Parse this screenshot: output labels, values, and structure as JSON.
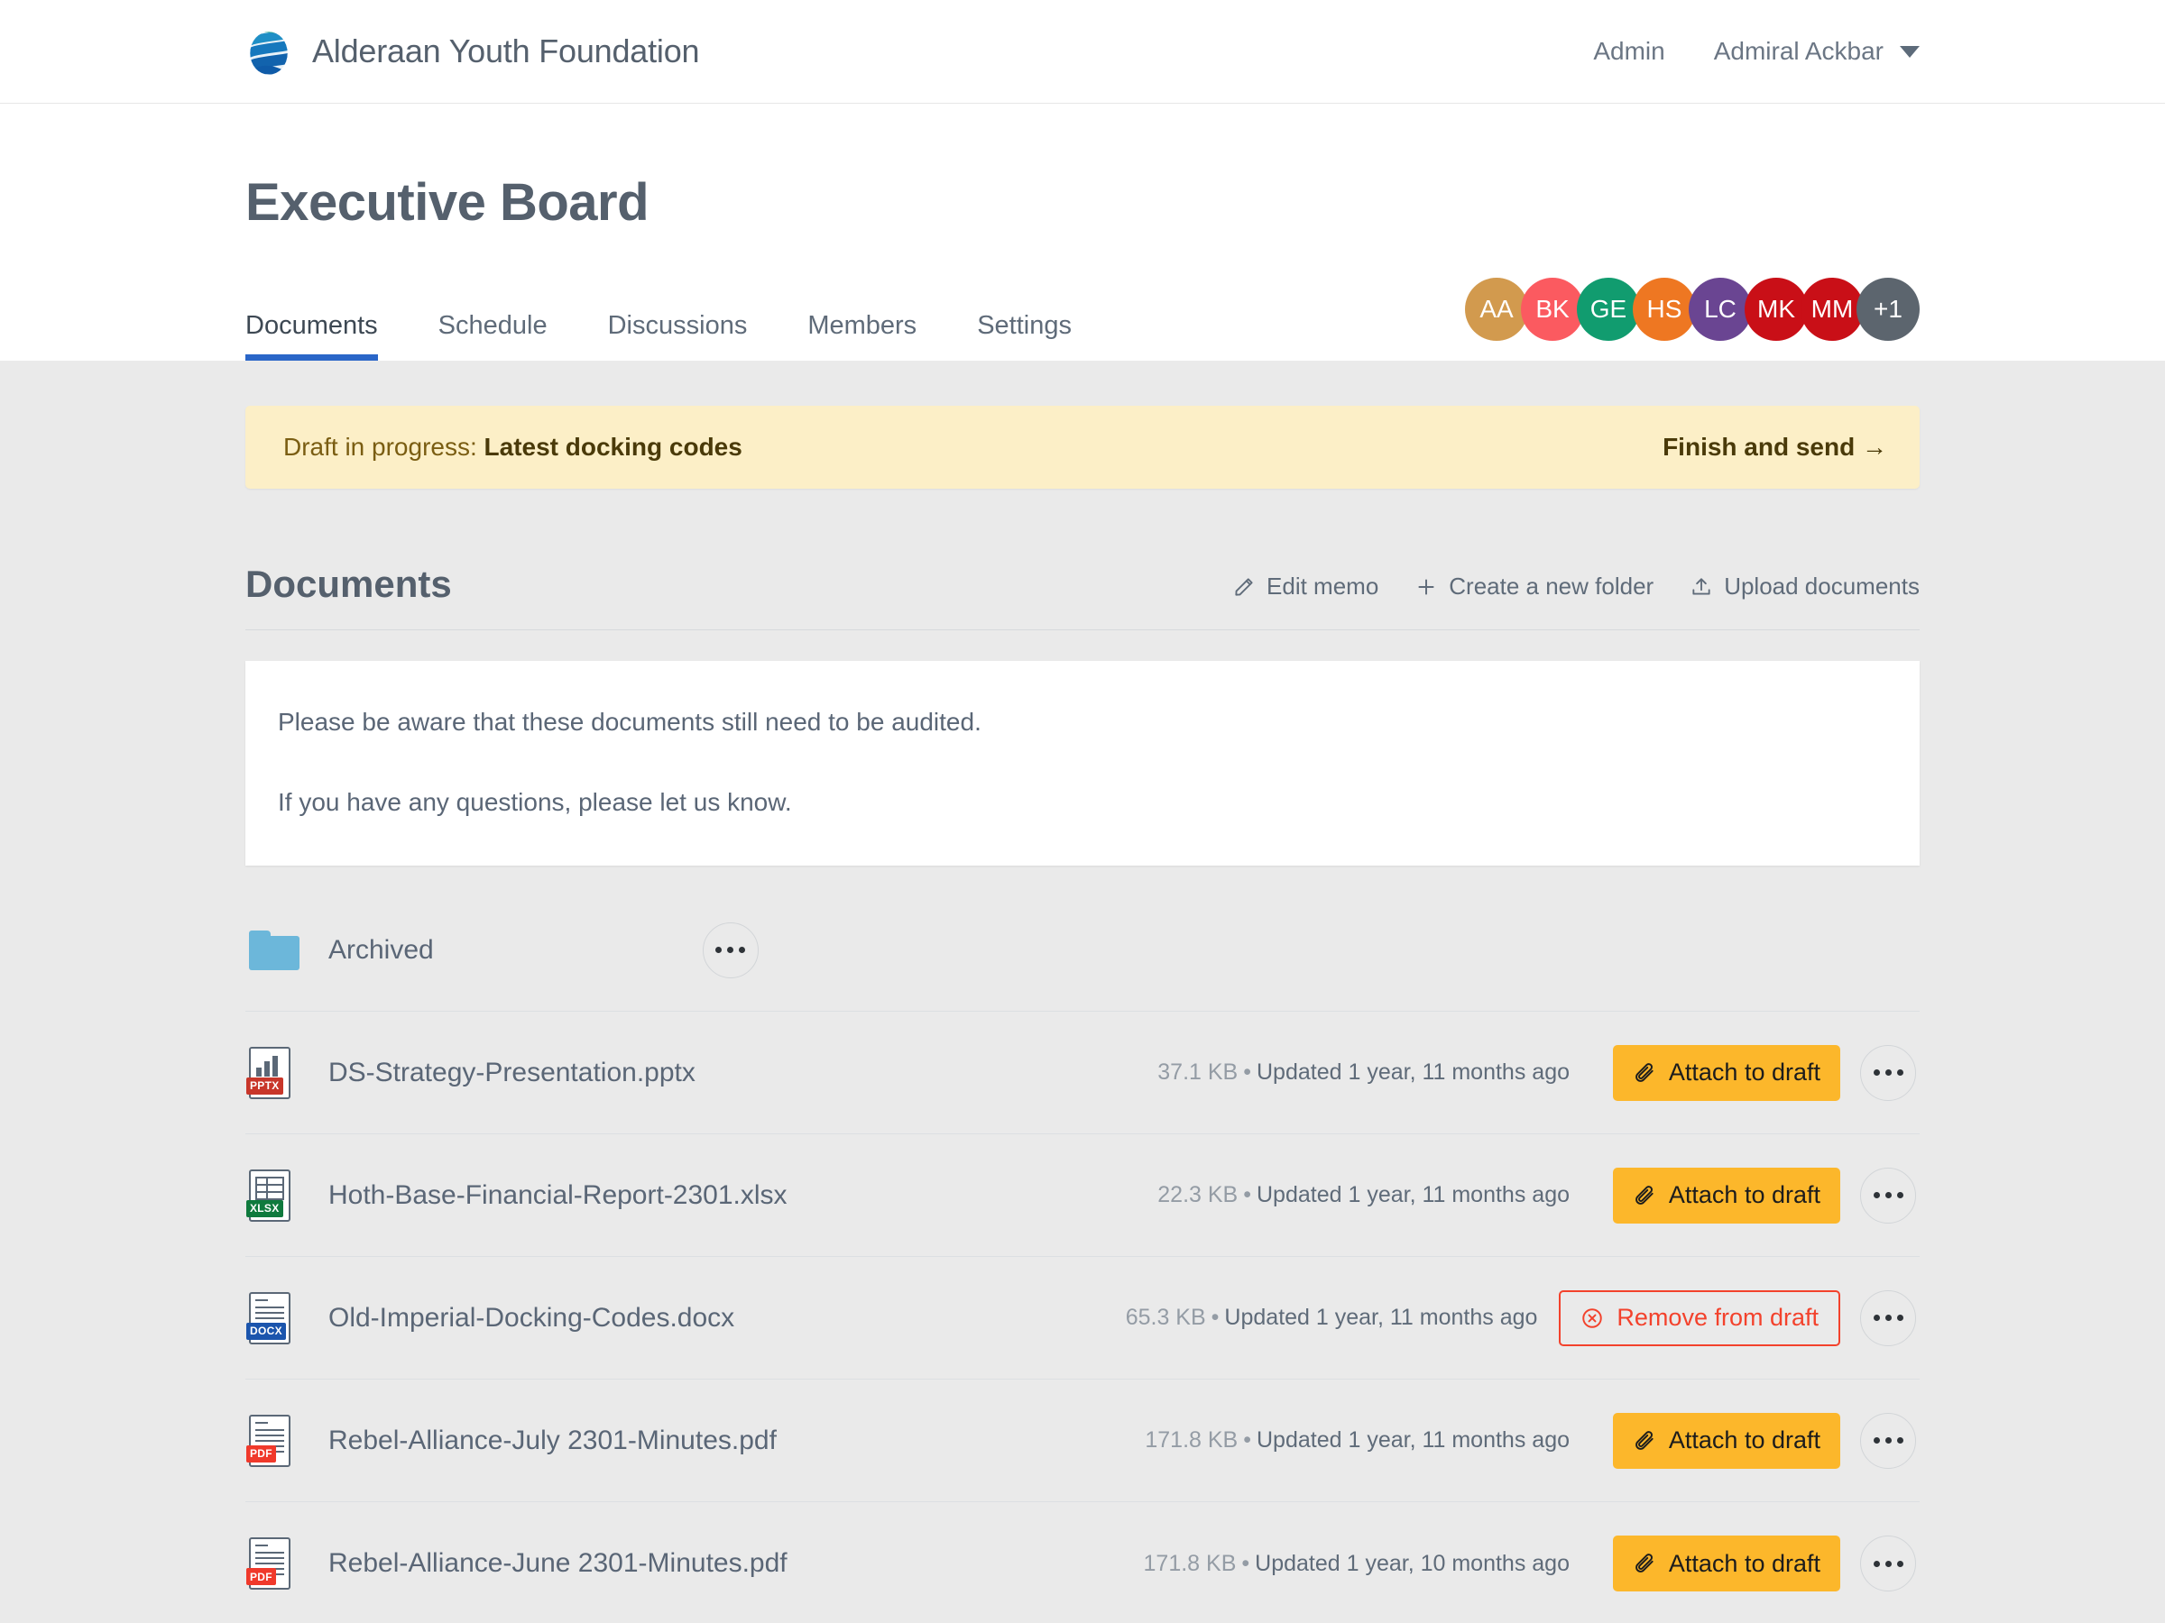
{
  "header": {
    "logo_icon": "globe-logo-icon",
    "brand": "Alderaan Youth Foundation",
    "admin_link": "Admin",
    "user_name": "Admiral Ackbar",
    "caret_icon": "chevron-down-icon"
  },
  "page": {
    "title": "Executive Board"
  },
  "tabs": [
    {
      "label": "Documents",
      "active": true
    },
    {
      "label": "Schedule",
      "active": false
    },
    {
      "label": "Discussions",
      "active": false
    },
    {
      "label": "Members",
      "active": false
    },
    {
      "label": "Settings",
      "active": false
    }
  ],
  "avatars": [
    {
      "initials": "AA",
      "color": "#d29a4e"
    },
    {
      "initials": "BK",
      "color": "#fb5a60"
    },
    {
      "initials": "GE",
      "color": "#119c6f"
    },
    {
      "initials": "HS",
      "color": "#ee7722"
    },
    {
      "initials": "LC",
      "color": "#6a4592"
    },
    {
      "initials": "MK",
      "color": "#c90f17"
    },
    {
      "initials": "MM",
      "color": "#c90f17"
    },
    {
      "initials": "+1",
      "color": "#5c656e"
    }
  ],
  "banner": {
    "prefix": "Draft in progress: ",
    "draft_name": "Latest docking codes",
    "action_label": "Finish and send →",
    "bg_color": "#fcefc7"
  },
  "documents_section": {
    "title": "Documents",
    "actions": [
      {
        "label": "Edit memo",
        "icon": "pencil-icon"
      },
      {
        "label": "Create a new folder",
        "icon": "plus-icon"
      },
      {
        "label": "Upload documents",
        "icon": "upload-icon"
      }
    ]
  },
  "memo": {
    "paragraph_1": "Please be aware that these documents still need to be audited.",
    "paragraph_2": "If you have any questions, please let us know."
  },
  "folder": {
    "name": "Archived",
    "icon": "folder-icon",
    "color": "#6cb7da",
    "more_icon": "ellipsis-icon"
  },
  "files": [
    {
      "name": "DS-Strategy-Presentation.pptx",
      "type": "pptx",
      "badge": "PPTX",
      "badge_color": "#c8362a",
      "size": "37.1 KB",
      "separator": "•",
      "updated": "Updated 1 year, 11 months ago",
      "action_label": "Attach to draft",
      "action_kind": "attach",
      "action_icon": "paperclip-icon",
      "more_icon": "ellipsis-icon"
    },
    {
      "name": "Hoth-Base-Financial-Report-2301.xlsx",
      "type": "xlsx",
      "badge": "XLSX",
      "badge_color": "#0f7a3d",
      "size": "22.3 KB",
      "separator": "•",
      "updated": "Updated 1 year, 11 months ago",
      "action_label": "Attach to draft",
      "action_kind": "attach",
      "action_icon": "paperclip-icon",
      "more_icon": "ellipsis-icon"
    },
    {
      "name": "Old-Imperial-Docking-Codes.docx",
      "type": "docx",
      "badge": "DOCX",
      "badge_color": "#1b55ad",
      "size": "65.3 KB",
      "separator": "•",
      "updated": "Updated 1 year, 11 months ago",
      "action_label": "Remove from draft",
      "action_kind": "remove",
      "action_icon": "circle-x-icon",
      "more_icon": "ellipsis-icon"
    },
    {
      "name": "Rebel-Alliance-July 2301-Minutes.pdf",
      "type": "pdf",
      "badge": "PDF",
      "badge_color": "#f0392b",
      "size": "171.8 KB",
      "separator": "•",
      "updated": "Updated 1 year, 11 months ago",
      "action_label": "Attach to draft",
      "action_kind": "attach",
      "action_icon": "paperclip-icon",
      "more_icon": "ellipsis-icon"
    },
    {
      "name": "Rebel-Alliance-June 2301-Minutes.pdf",
      "type": "pdf",
      "badge": "PDF",
      "badge_color": "#f0392b",
      "size": "171.8 KB",
      "separator": "•",
      "updated": "Updated 1 year, 10 months ago",
      "action_label": "Attach to draft",
      "action_kind": "attach",
      "action_icon": "paperclip-icon",
      "more_icon": "ellipsis-icon"
    }
  ],
  "colors": {
    "accent_blue": "#2a66c8",
    "attach_amber": "#fcb72b",
    "remove_red": "#f3422c",
    "page_bg": "#eaeaea"
  }
}
